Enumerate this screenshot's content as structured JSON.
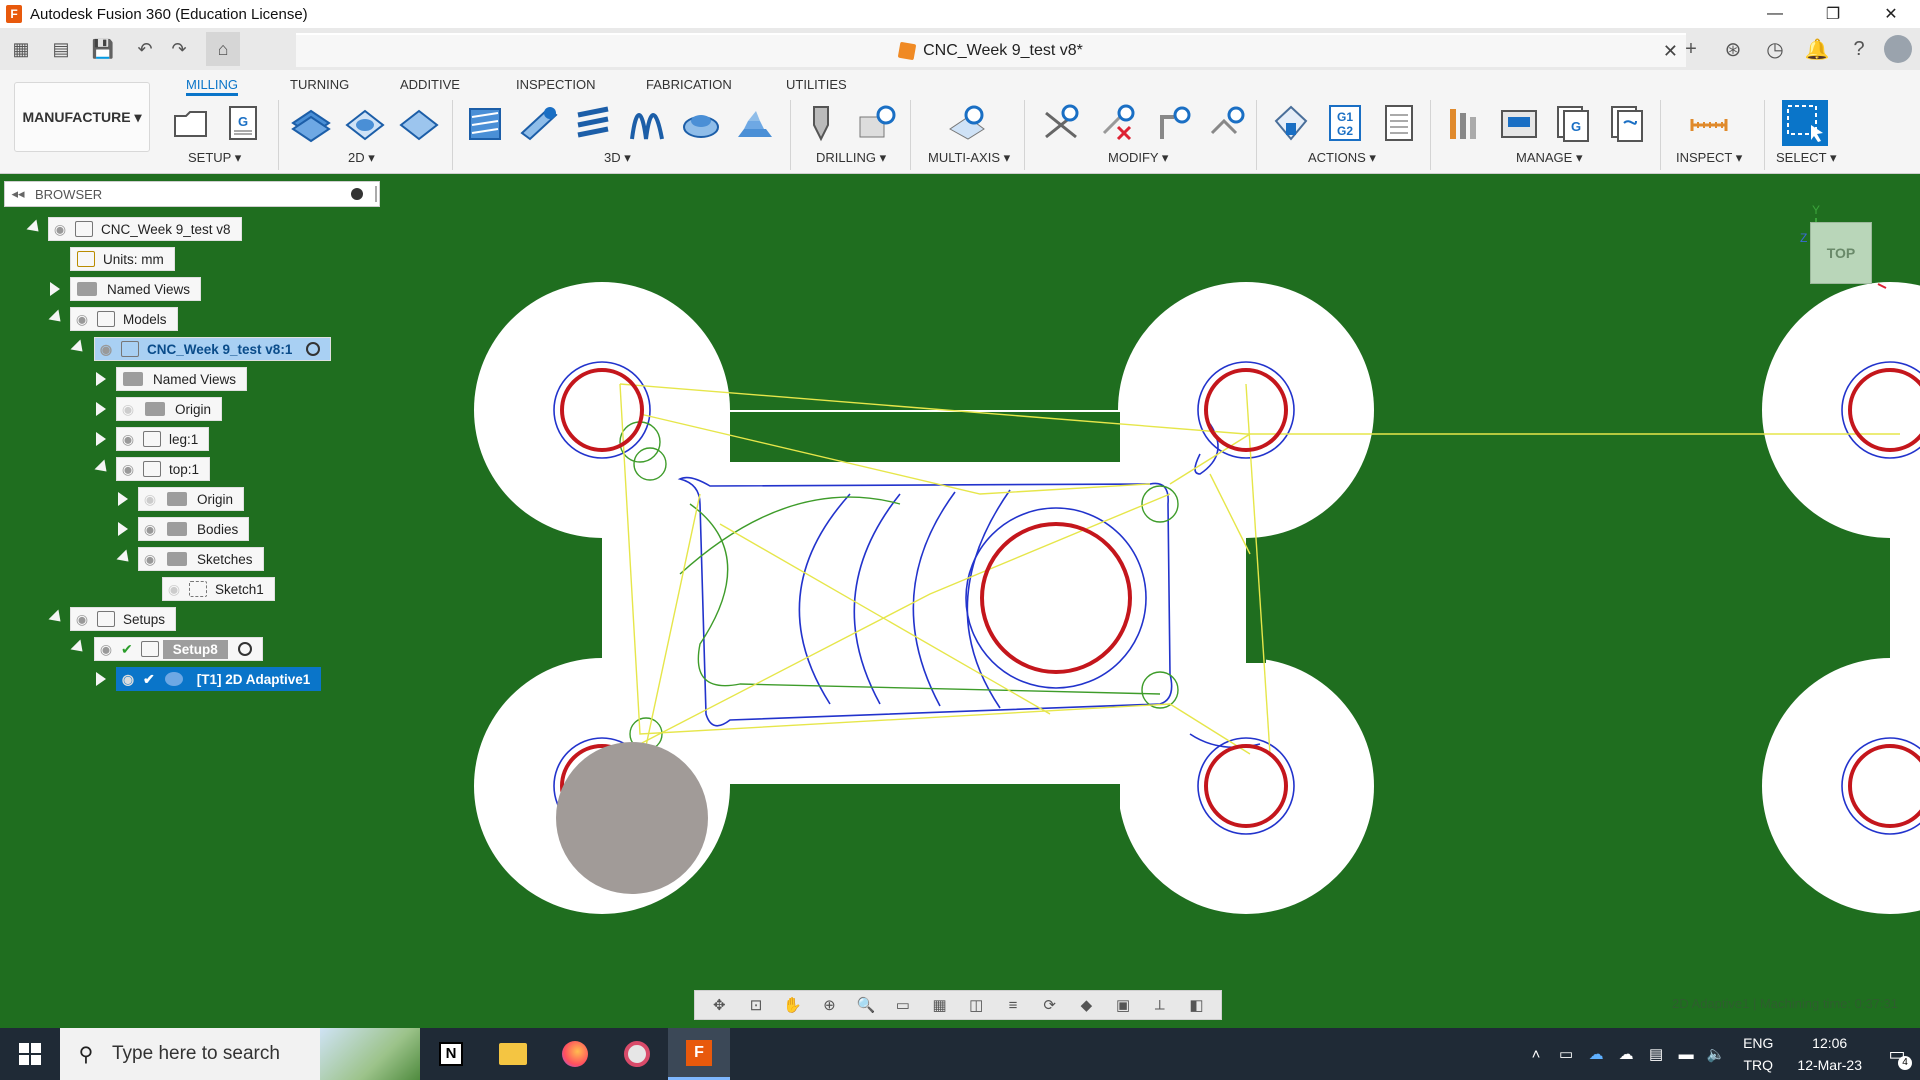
{
  "titlebar": {
    "title": "Autodesk Fusion 360 (Education License)",
    "minimize": "—",
    "restore": "❐",
    "close": "✕"
  },
  "document": {
    "tab_title": "CNC_Week 9_test v8*",
    "close": "✕"
  },
  "ribbon": {
    "workspace": "MANUFACTURE ▾",
    "tabs": [
      "MILLING",
      "TURNING",
      "ADDITIVE",
      "INSPECTION",
      "FABRICATION",
      "UTILITIES"
    ],
    "groups": [
      "SETUP ▾",
      "2D ▾",
      "3D ▾",
      "DRILLING ▾",
      "MULTI-AXIS ▾",
      "MODIFY ▾",
      "ACTIONS ▾",
      "MANAGE ▾",
      "INSPECT ▾",
      "SELECT ▾"
    ],
    "g1g2_label_top": "G1",
    "g1g2_label_bottom": "G2",
    "setup_g": "G",
    "manage_g": "G"
  },
  "browser": {
    "title": "BROWSER",
    "items": [
      {
        "label": "CNC_Week 9_test v8"
      },
      {
        "label": "Units: mm"
      },
      {
        "label": "Named Views"
      },
      {
        "label": "Models"
      },
      {
        "label": "CNC_Week 9_test v8:1"
      },
      {
        "label": "Named Views"
      },
      {
        "label": "Origin"
      },
      {
        "label": "leg:1"
      },
      {
        "label": "top:1"
      },
      {
        "label": "Origin"
      },
      {
        "label": "Bodies"
      },
      {
        "label": "Sketches"
      },
      {
        "label": "Sketch1"
      },
      {
        "label": "Setups"
      },
      {
        "label": "Setup8"
      },
      {
        "label": "[T1] 2D Adaptive1"
      }
    ]
  },
  "viewcube": {
    "face": "TOP",
    "axis_y": "Y",
    "axis_z": "Z"
  },
  "status": {
    "text": "2D Adaptive1 | Machining time: 0:37:31"
  },
  "taskbar": {
    "search_placeholder": "Type here to search",
    "lang_top": "ENG",
    "lang_bottom": "TRQ",
    "time": "12:06",
    "date": "12-Mar-23",
    "notification_count": "4"
  },
  "colors": {
    "viewport": "#1f6e1f",
    "accent": "#0a75c9",
    "toolpath_yellow": "#e6e64a",
    "toolpath_blue": "#2233cc",
    "hole_red": "#c4161c"
  }
}
